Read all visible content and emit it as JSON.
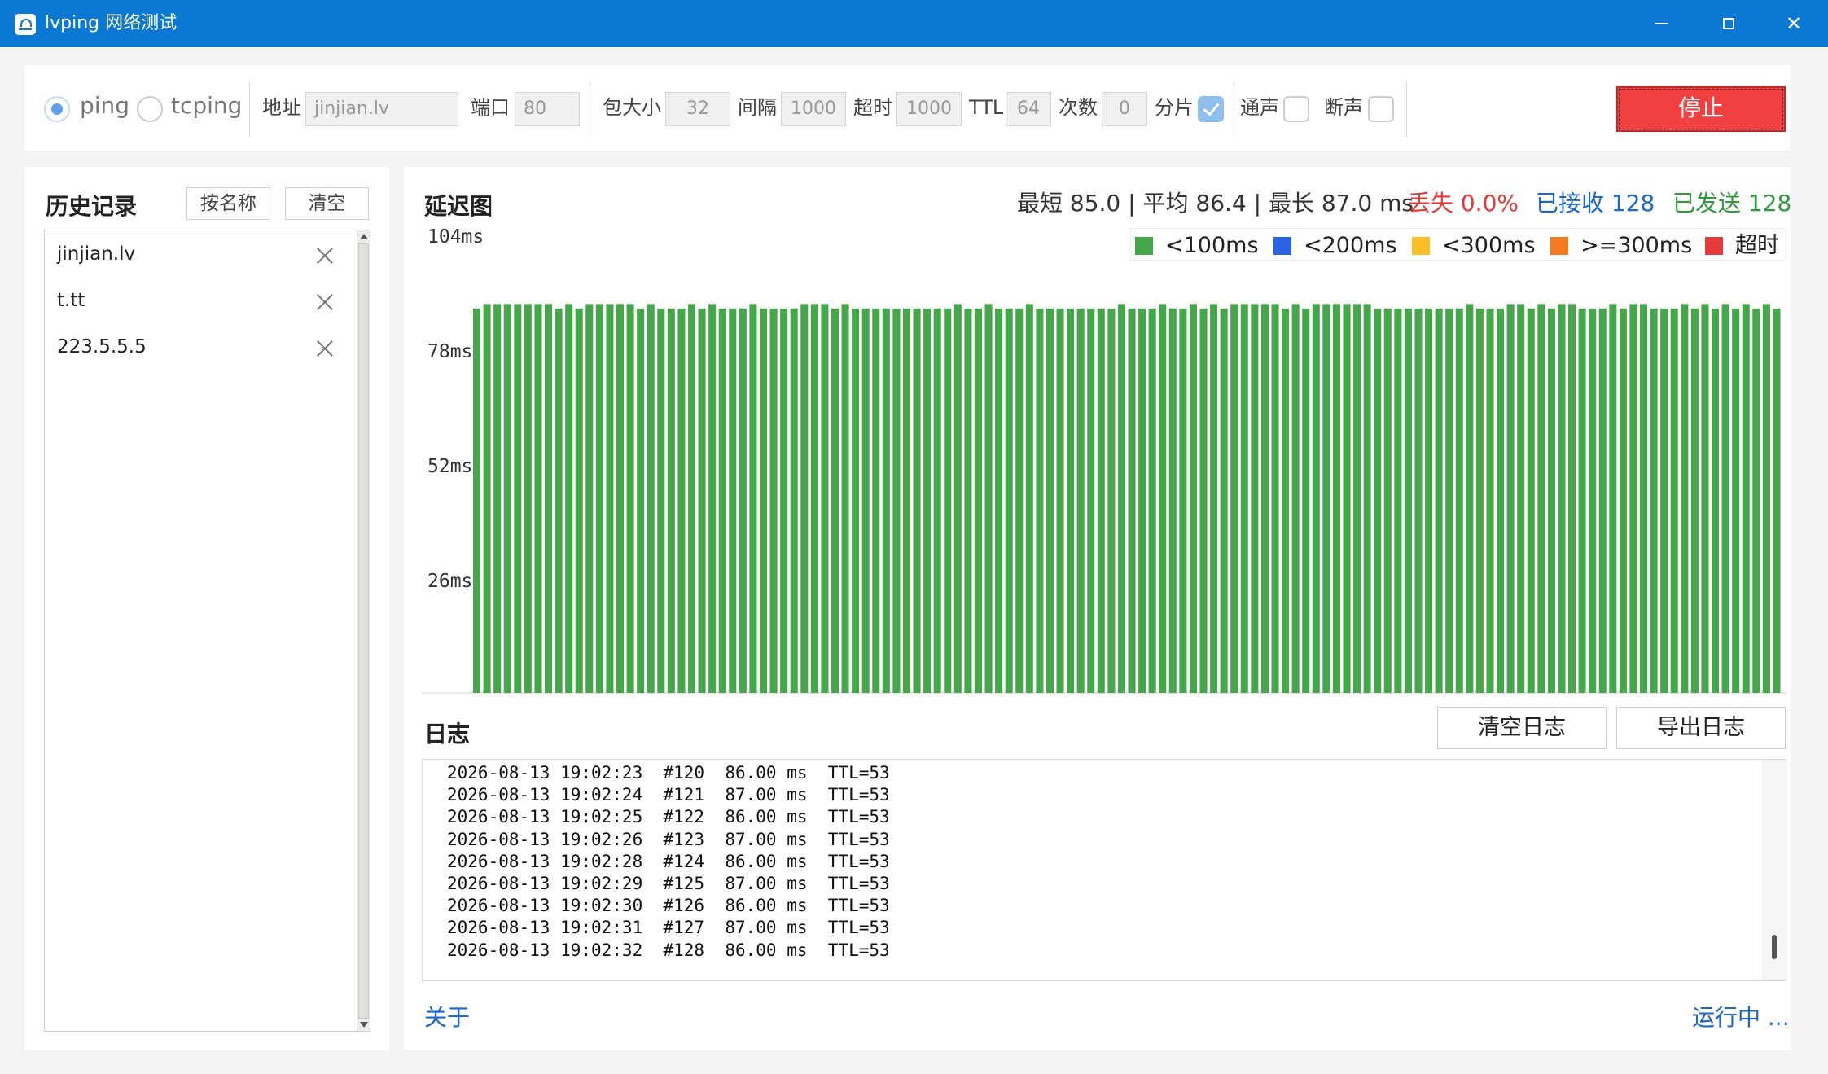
{
  "window": {
    "title": "lvping 网络测试",
    "controls": [
      "minimize",
      "maximize",
      "close"
    ]
  },
  "toolbar": {
    "modes": [
      {
        "label": "ping",
        "selected": true
      },
      {
        "label": "tcping",
        "selected": false
      }
    ],
    "address_label": "地址",
    "address_value": "jinjian.lv",
    "port_label": "端口",
    "port_value": "80",
    "packet_size_label": "包大小",
    "packet_size_value": "32",
    "interval_label": "间隔",
    "interval_value": "1000",
    "timeout_label": "超时",
    "timeout_value": "1000",
    "ttl_label": "TTL",
    "ttl_value": "64",
    "count_label": "次数",
    "count_value": "0",
    "fragment_label": "分片",
    "fragment_checked": true,
    "beep_ok_label": "通声",
    "beep_ok_checked": false,
    "beep_fail_label": "断声",
    "beep_fail_checked": false,
    "stop_label": "停止"
  },
  "history": {
    "title": "历史记录",
    "sort_label": "按名称",
    "clear_label": "清空",
    "items": [
      "jinjian.lv",
      "t.tt",
      "223.5.5.5"
    ]
  },
  "stats": {
    "latency_text": "最短 85.0 | 平均 86.4 | 最长 87.0 ms",
    "loss_text": "丢失 0.0%",
    "received_text": "已接收 128",
    "sent_text": "已发送 128"
  },
  "chart_title": "延迟图",
  "chart_data": {
    "type": "bar",
    "title": "",
    "ylabel": "",
    "xlabel": "",
    "ylim": [
      0,
      104
    ],
    "yticks": [
      "104ms",
      "78ms",
      "52ms",
      "26ms"
    ],
    "legend_position": "top-right",
    "legend": [
      {
        "label": "<100ms",
        "color": "#46a74a"
      },
      {
        "label": "<200ms",
        "color": "#2b63e6"
      },
      {
        "label": "<300ms",
        "color": "#f9c129"
      },
      {
        "label": ">=300ms",
        "color": "#f47a22"
      },
      {
        "label": "超时",
        "color": "#e63b3b"
      }
    ],
    "bar_color": "#46a74a",
    "values": [
      86,
      87,
      87,
      87,
      87,
      87,
      87,
      87,
      86,
      87,
      86,
      87,
      87,
      87,
      87,
      87,
      86,
      87,
      86,
      86,
      86,
      87,
      86,
      87,
      86,
      86,
      86,
      87,
      86,
      86,
      86,
      86,
      87,
      87,
      87,
      86,
      87,
      86,
      86,
      86,
      86,
      86,
      86,
      86,
      86,
      86,
      86,
      87,
      86,
      86,
      87,
      86,
      86,
      86,
      87,
      86,
      86,
      86,
      86,
      86,
      86,
      86,
      86,
      87,
      86,
      86,
      86,
      87,
      86,
      86,
      87,
      86,
      87,
      86,
      87,
      87,
      87,
      87,
      87,
      86,
      87,
      86,
      87,
      87,
      87,
      87,
      87,
      87,
      86,
      86,
      86,
      86,
      86,
      86,
      86,
      86,
      86,
      87,
      86,
      86,
      86,
      87,
      87,
      86,
      87,
      86,
      87,
      87,
      86,
      86,
      86,
      87,
      86,
      87,
      87,
      86,
      86,
      86,
      87,
      86,
      87,
      86,
      87,
      86,
      87,
      86,
      87,
      86
    ]
  },
  "log": {
    "title": "日志",
    "clear_label": "清空日志",
    "export_label": "导出日志",
    "lines": [
      "2026-08-13 19:02:23  #120  86.00 ms  TTL=53",
      "2026-08-13 19:02:24  #121  87.00 ms  TTL=53",
      "2026-08-13 19:02:25  #122  86.00 ms  TTL=53",
      "2026-08-13 19:02:26  #123  87.00 ms  TTL=53",
      "2026-08-13 19:02:28  #124  86.00 ms  TTL=53",
      "2026-08-13 19:02:29  #125  87.00 ms  TTL=53",
      "2026-08-13 19:02:30  #126  86.00 ms  TTL=53",
      "2026-08-13 19:02:31  #127  87.00 ms  TTL=53",
      "2026-08-13 19:02:32  #128  86.00 ms  TTL=53"
    ]
  },
  "footer": {
    "about_label": "关于",
    "status_label": "运行中 ..."
  },
  "colors": {
    "titlebar": "#0b78d4",
    "stop_button": "#f04040",
    "loss": "#e53935",
    "received": "#1a66d6",
    "sent": "#2e9a3c",
    "link": "#1a66d6"
  }
}
